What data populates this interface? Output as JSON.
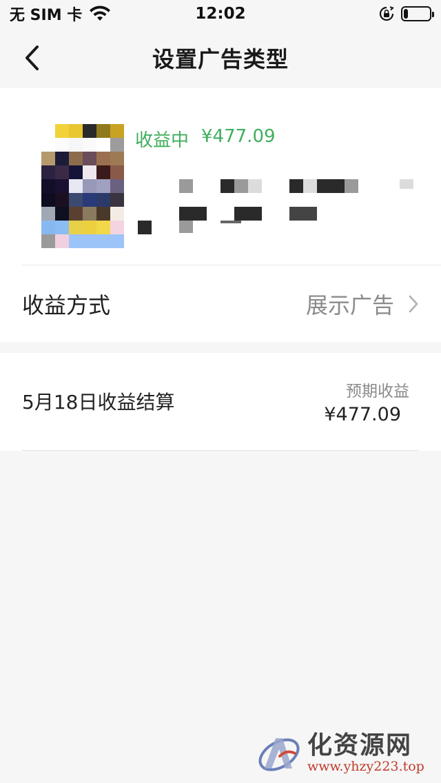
{
  "status_bar": {
    "carrier": "无 SIM 卡",
    "time": "12:02"
  },
  "nav": {
    "title": "设置广告类型"
  },
  "ad_card": {
    "status": "收益中",
    "amount": "¥477.09"
  },
  "method_row": {
    "label": "收益方式",
    "value": "展示广告"
  },
  "settlement": {
    "label": "5月18日收益结算",
    "expected_label": "预期收益",
    "expected_amount": "¥477.09"
  },
  "watermark": {
    "title": "化资源网",
    "url": "www.yhzy223.top"
  },
  "colors": {
    "accent_green": "#3fae5c",
    "muted_gray": "#8a8a8a"
  }
}
